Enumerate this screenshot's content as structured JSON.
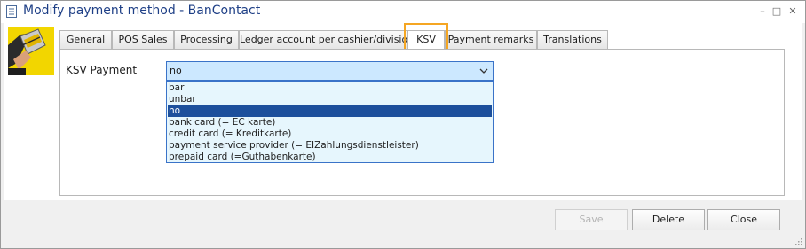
{
  "window": {
    "title": "Modify payment method - BanContact",
    "minimize_glyph": "–",
    "maximize_glyph": "□",
    "close_glyph": "✕"
  },
  "tabs": [
    {
      "label": "General"
    },
    {
      "label": "POS Sales"
    },
    {
      "label": "Processing"
    },
    {
      "label": "Ledger account per cashier/division"
    },
    {
      "label": "KSV"
    },
    {
      "label": "Payment remarks"
    },
    {
      "label": "Translations"
    }
  ],
  "active_tab": "KSV",
  "ksv": {
    "label": "KSV Payment",
    "selected_value": "no",
    "options": [
      {
        "label": "bar"
      },
      {
        "label": "unbar"
      },
      {
        "label": "no"
      },
      {
        "label": "bank card (= EC karte)"
      },
      {
        "label": "credit card (= Kreditkarte)"
      },
      {
        "label": "payment service provider (= EIZahlungsdienstleister)"
      },
      {
        "label": "prepaid card (=Guthabenkarte)"
      }
    ]
  },
  "buttons": {
    "save": "Save",
    "delete": "Delete",
    "close": "Close"
  },
  "colors": {
    "title_text": "#1e3f86",
    "highlight": "#f5a623",
    "selection": "#1c4f9c",
    "dropdown_bg": "#e6f6fd"
  },
  "icons": {
    "title": "document-icon",
    "logo": "bancontact-card-logo",
    "dropdown": "chevron-down-icon",
    "minimize": "minimize-icon",
    "maximize": "maximize-icon",
    "close": "close-icon"
  }
}
